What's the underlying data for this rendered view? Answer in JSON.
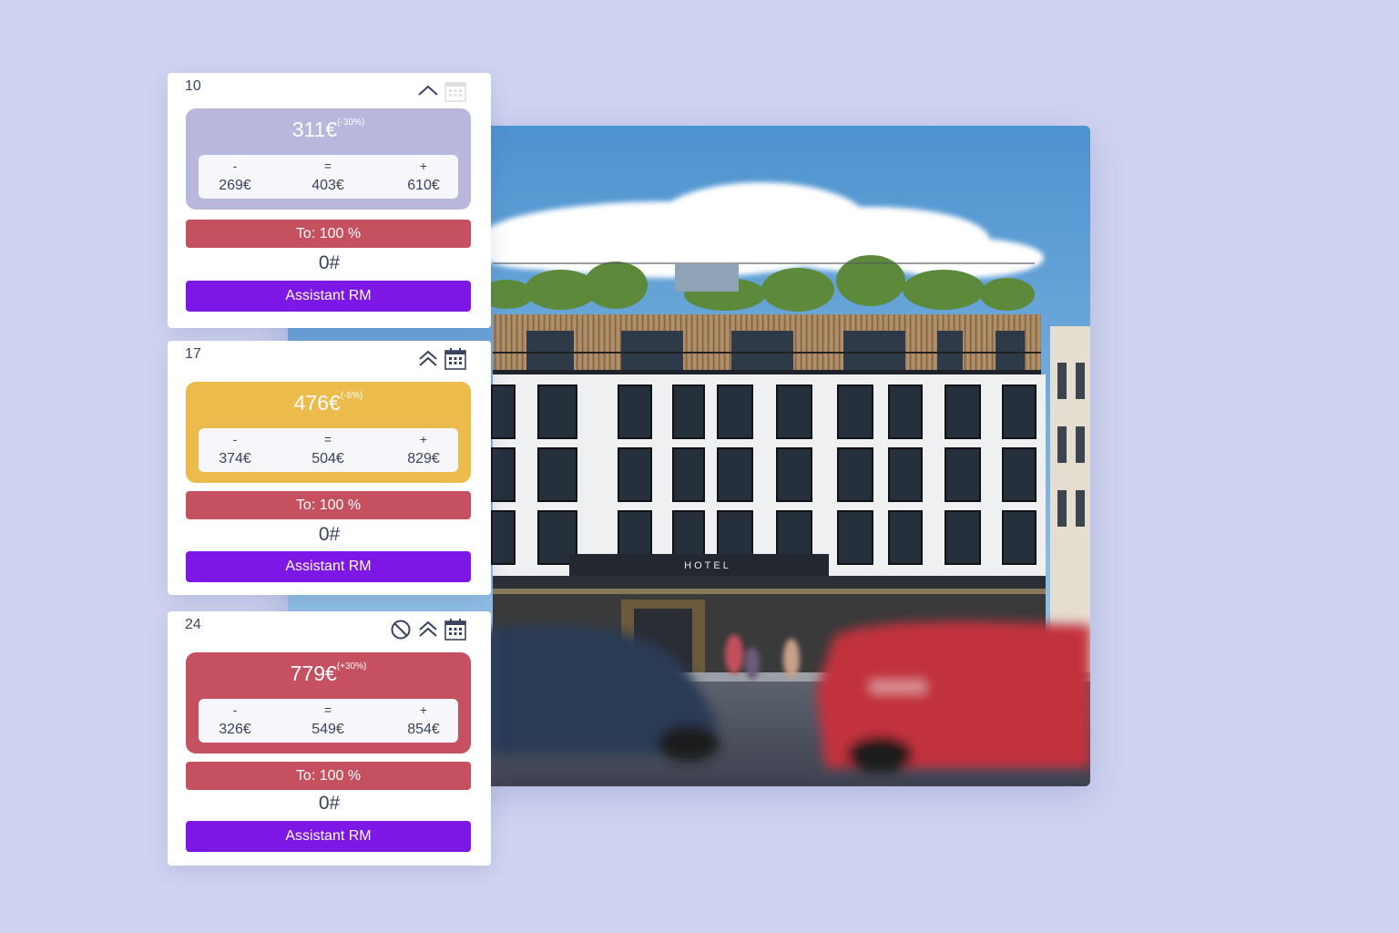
{
  "hero": {
    "sign_text": "HOTEL"
  },
  "colors": {
    "background": "#d0d4f0",
    "lavender": "#b8b8dc",
    "amber": "#ebbb4b",
    "red": "#c5505f",
    "purple": "#7d17e6"
  },
  "cards": [
    {
      "day": "10",
      "icons": [
        "chevron-up-icon",
        "calendar-icon"
      ],
      "price": "311€",
      "change": "(-30%)",
      "box_color": "lavender",
      "range": {
        "min_symbol": "-",
        "mid_symbol": "=",
        "max_symbol": "+",
        "min": "269€",
        "mid": "403€",
        "max": "610€"
      },
      "occupancy": "To: 100 %",
      "count": "0#",
      "button_label": "Assistant RM"
    },
    {
      "day": "17",
      "icons": [
        "double-chevron-up-icon",
        "calendar-icon"
      ],
      "price": "476€",
      "change": "(-6%)",
      "box_color": "amber",
      "range": {
        "min_symbol": "-",
        "mid_symbol": "=",
        "max_symbol": "+",
        "min": "374€",
        "mid": "504€",
        "max": "829€"
      },
      "occupancy": "To: 100 %",
      "count": "0#",
      "button_label": "Assistant RM"
    },
    {
      "day": "24",
      "icons": [
        "no-entry-icon",
        "double-chevron-up-icon",
        "calendar-icon"
      ],
      "price": "779€",
      "change": "(+30%)",
      "box_color": "red",
      "range": {
        "min_symbol": "-",
        "mid_symbol": "=",
        "max_symbol": "+",
        "min": "326€",
        "mid": "549€",
        "max": "854€"
      },
      "occupancy": "To: 100 %",
      "count": "0#",
      "button_label": "Assistant RM"
    }
  ]
}
